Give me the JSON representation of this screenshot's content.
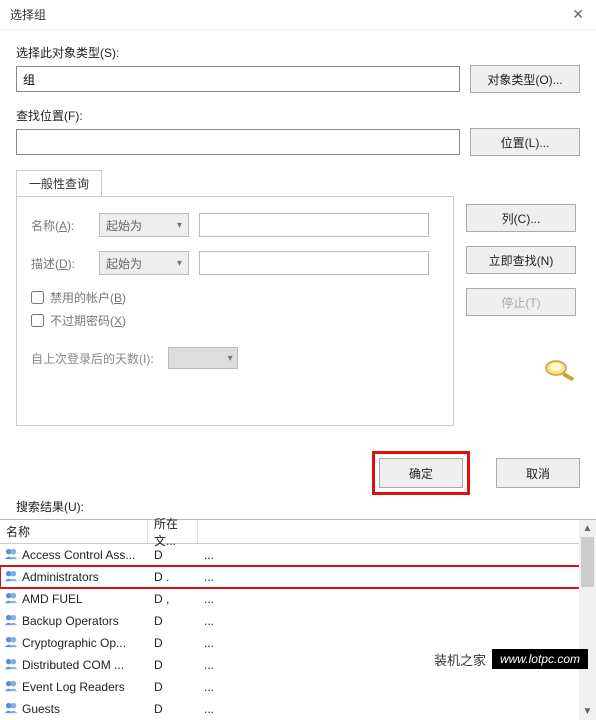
{
  "titlebar": {
    "title": "选择组",
    "close": "✕"
  },
  "object_type": {
    "label": "选择此对象类型(S):",
    "value": "组",
    "button": "对象类型(O)..."
  },
  "location": {
    "label": "查找位置(F):",
    "value": "",
    "button": "位置(L)..."
  },
  "tabs": {
    "general": "一般性查询"
  },
  "form": {
    "name_label_pre": "名称(",
    "name_label_ul": "A",
    "name_label_post": "):",
    "desc_label_pre": "描述(",
    "desc_label_ul": "D",
    "desc_label_post": "):",
    "starts_with": "起始为",
    "disabled_pre": "禁用的帐户(",
    "disabled_ul": "B",
    "disabled_post": ")",
    "noexp_pre": "不过期密码(",
    "noexp_ul": "X",
    "noexp_post": ")",
    "days_label": "自上次登录后的天数(I):"
  },
  "side": {
    "columns": "列(C)...",
    "findnow": "立即查找(N)",
    "stop": "停止(T)"
  },
  "actions": {
    "ok": "确定",
    "cancel": "取消"
  },
  "results_label": "搜索结果(U):",
  "columns": {
    "name": "名称",
    "folder": "所在文..."
  },
  "rows": [
    {
      "name": "Access Control Ass...",
      "folder": "D",
      "dots": "...",
      "sel": false
    },
    {
      "name": "Administrators",
      "folder": "D .",
      "dots": "...",
      "sel": true
    },
    {
      "name": "AMD FUEL",
      "folder": "D ,",
      "dots": "...",
      "sel": false
    },
    {
      "name": "Backup Operators",
      "folder": "D",
      "dots": "...",
      "sel": false
    },
    {
      "name": "Cryptographic Op...",
      "folder": "D",
      "dots": "...",
      "sel": false
    },
    {
      "name": "Distributed COM ...",
      "folder": "D",
      "dots": "...",
      "sel": false
    },
    {
      "name": "Event Log Readers",
      "folder": "D",
      "dots": "...",
      "sel": false
    },
    {
      "name": "Guests",
      "folder": "D",
      "dots": "...",
      "sel": false
    }
  ],
  "watermark": {
    "zh": "装机之家",
    "url": "www.lotpc.com"
  }
}
